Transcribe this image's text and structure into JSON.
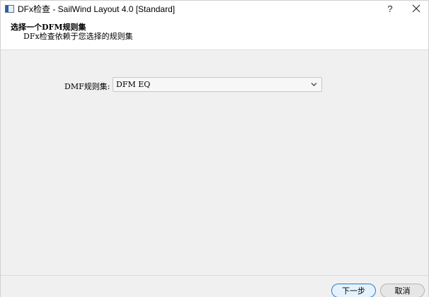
{
  "window": {
    "title": "DFx检查 - SailWind Layout 4.0 [Standard]",
    "help_label": "?"
  },
  "header": {
    "title": "选择一个DFM规则集",
    "subtitle": "DFx检查依赖于您选择的规则集"
  },
  "form": {
    "rule_set_label": "DMF规则集:",
    "rule_set_value": "DFM EQ"
  },
  "footer": {
    "next_label": "下一步",
    "cancel_label": "取消"
  },
  "colors": {
    "primary_button_border": "#2b7bd0",
    "primary_button_bg": "#e5f1fb",
    "dialog_bg": "#f0f0f0"
  },
  "icons": {
    "app": "app-window-icon",
    "close": "close-icon",
    "dropdown": "chevron-down-icon"
  }
}
